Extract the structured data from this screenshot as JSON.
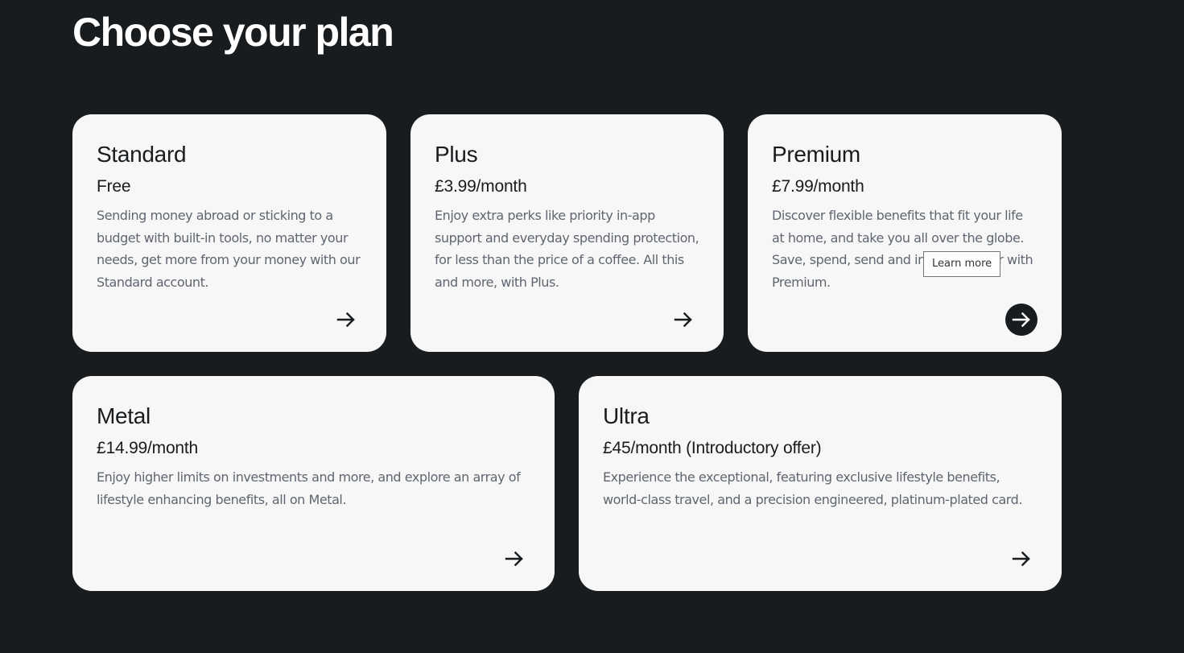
{
  "page": {
    "title": "Choose your plan"
  },
  "plans": [
    {
      "name": "Standard",
      "price": "Free",
      "description": "Sending money abroad or sticking to a budget with built-in tools, no matter your needs, get more from your money with our Standard account."
    },
    {
      "name": "Plus",
      "price": "£3.99/month",
      "description": "Enjoy extra perks like priority in-app support and everyday spending protection, for less than the price of a coffee. All this and more, with Plus."
    },
    {
      "name": "Premium",
      "price": "£7.99/month",
      "description": "Discover flexible benefits that fit your life at home, and take you all over the globe. Save, spend, send and invest smarter with Premium."
    },
    {
      "name": "Metal",
      "price": "£14.99/month",
      "description": "Enjoy higher limits on investments and more, and explore an array of lifestyle enhancing benefits, all on Metal."
    },
    {
      "name": "Ultra",
      "price": "£45/month (Introductory offer)",
      "description": "Experience the exceptional, featuring exclusive lifestyle benefits, world-class travel, and a precision engineered, platinum-plated card."
    }
  ],
  "tooltip": {
    "text": "Learn more"
  },
  "icons": {
    "arrow": "arrow-right-icon"
  },
  "colors": {
    "background": "#191c1f",
    "card": "#f7f7f7",
    "text": "#191c1f",
    "muted_text": "#5f6670",
    "active_button": "#191c1f"
  }
}
